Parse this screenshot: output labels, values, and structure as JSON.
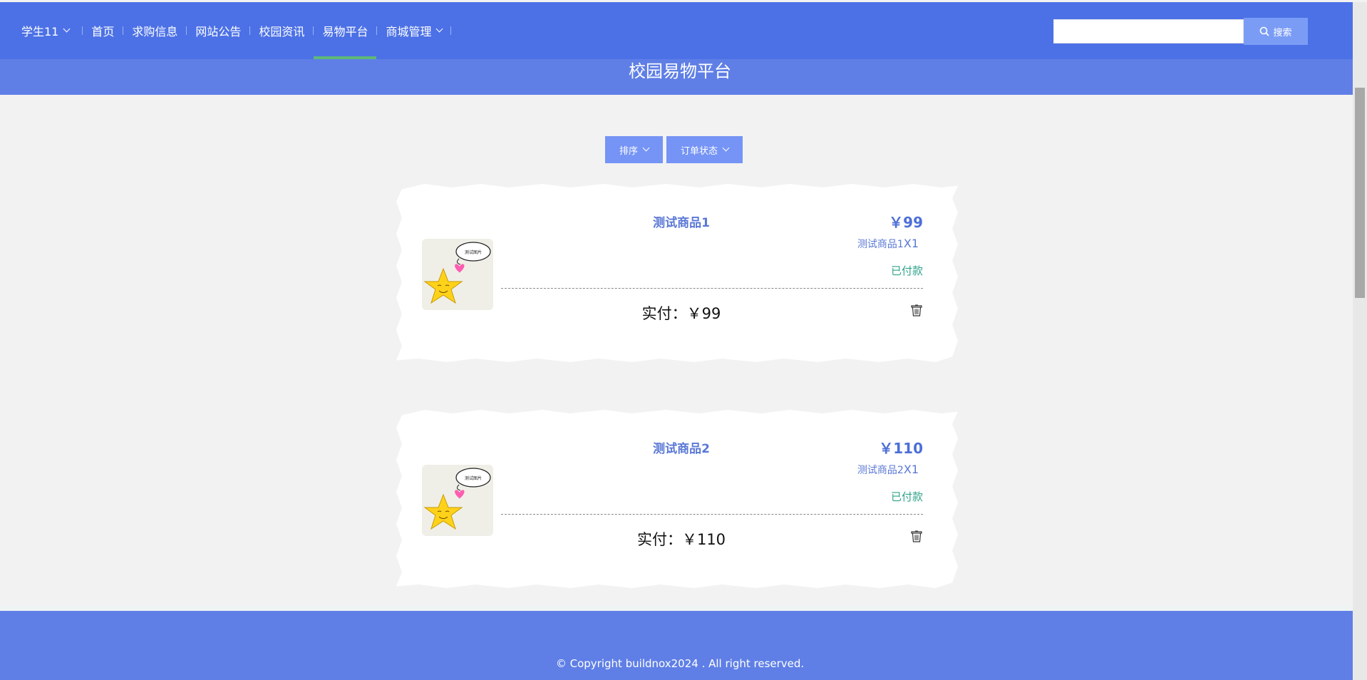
{
  "nav": {
    "user": "学生11",
    "items": [
      "首页",
      "求购信息",
      "网站公告",
      "校园资讯",
      "易物平台",
      "商城管理"
    ],
    "active": "易物平台"
  },
  "search": {
    "placeholder": "",
    "button_label": "搜索"
  },
  "page_title": "校园易物平台",
  "filters": {
    "sort_label": "排序",
    "status_label": "订单状态"
  },
  "orders": [
    {
      "name": "测试商品1",
      "price": "￥99",
      "qty_name": "测试商品1",
      "qty": "X1",
      "status": "已付款",
      "paid": "实付：￥99"
    },
    {
      "name": "测试商品2",
      "price": "￥110",
      "qty_name": "测试商品2",
      "qty": "X1",
      "status": "已付款",
      "paid": "实付：￥110"
    }
  ],
  "image_caption": "测试图片",
  "footer": {
    "copyright": "© Copyright buildnox2024 . All right reserved."
  },
  "colors": {
    "navbar": "#4c71e6",
    "title_band": "#5f7fe6",
    "active_underline": "#5fb878",
    "status_paid": "#2ea38a"
  }
}
